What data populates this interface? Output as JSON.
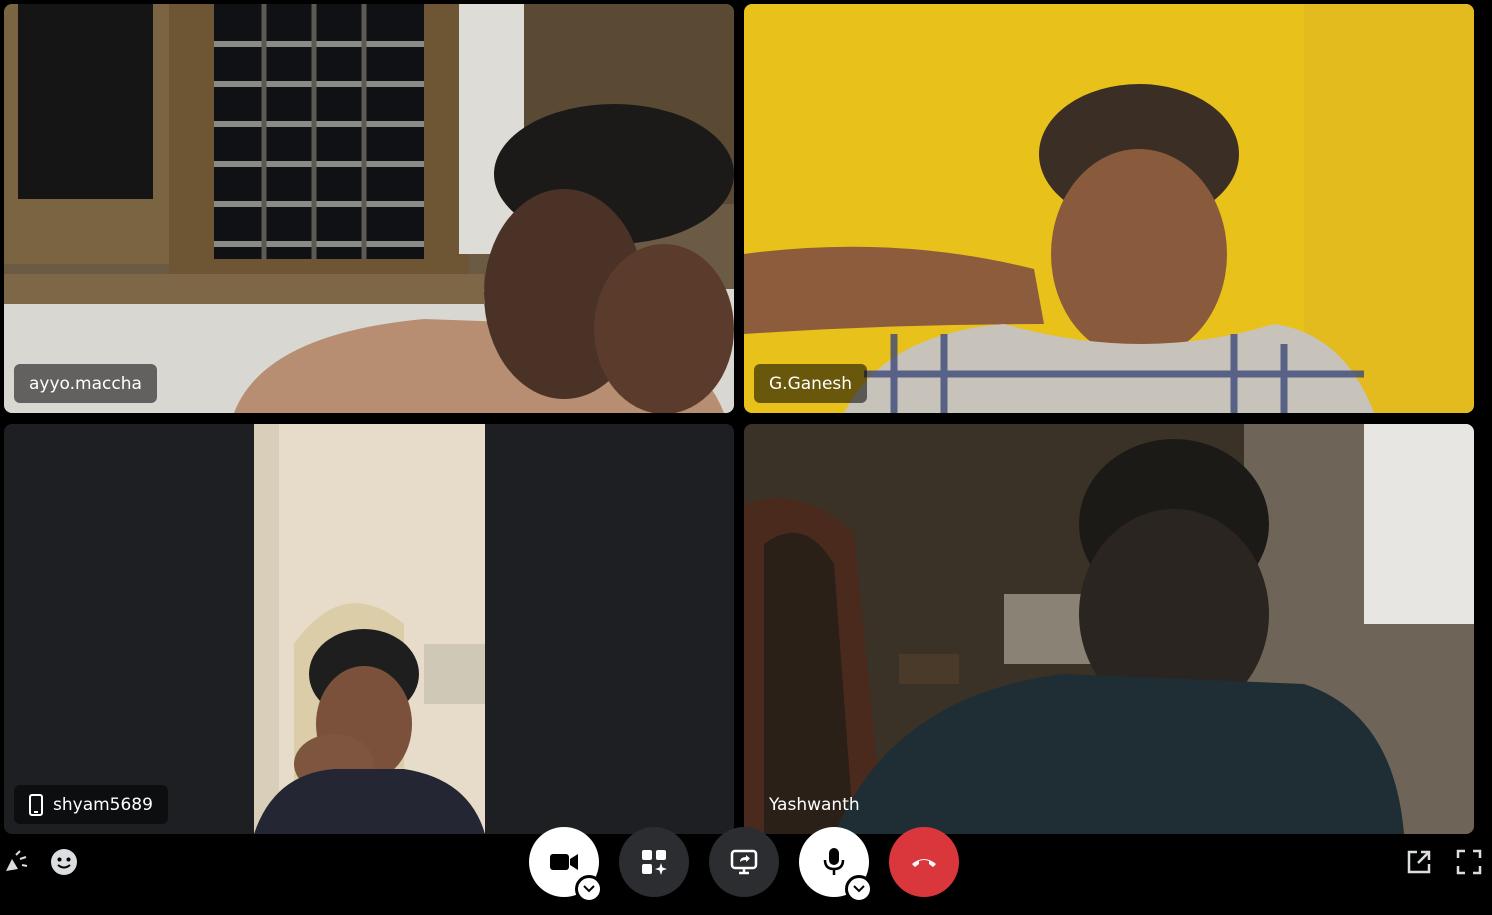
{
  "participants": [
    {
      "name": "ayyo.maccha",
      "device": ""
    },
    {
      "name": "G.Ganesh",
      "device": ""
    },
    {
      "name": "shyam5689",
      "device": "mobile-icon"
    },
    {
      "name": "Yashwanth",
      "device": ""
    }
  ],
  "controls": {
    "camera": "camera-icon",
    "activities": "activities-icon",
    "screen_share": "screen-share-icon",
    "microphone": "microphone-icon",
    "disconnect": "hang-up-icon"
  },
  "colors": {
    "background": "#000000",
    "tile": "#1e1f22",
    "control_dark": "#2b2d31",
    "disconnect_red": "#da373c"
  }
}
